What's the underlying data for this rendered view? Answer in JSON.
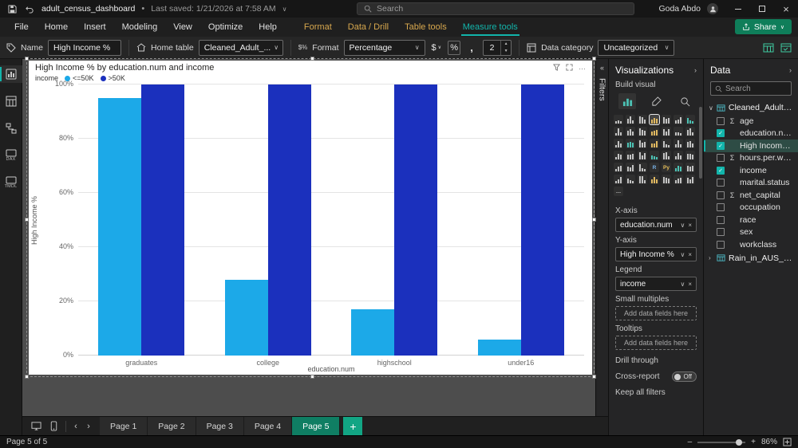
{
  "colors": {
    "accent_teal": "#12b5ab",
    "contextual_tab_yellow": "#d8a84e",
    "share_button_green": "#0f7e5a",
    "bar_light_blue": "#1ca9e8",
    "bar_dark_blue": "#1b30bd"
  },
  "icons": {
    "dot": "•",
    "chevron_down": "∨",
    "chevron_right": "›",
    "chevron_left": "‹",
    "collapse_left": "«",
    "close": "×",
    "more": "…",
    "check": "✓",
    "sigma": "Σ",
    "minus": "–",
    "plus": "+",
    "format_symbol": "$%",
    "up": "▲",
    "down": "▼"
  },
  "titlebar": {
    "filename": "adult_census_dashboard",
    "last_saved": "Last saved: 1/21/2026 at 7:58 AM",
    "search_placeholder": "Search",
    "user_name": "Goda Abdo"
  },
  "ribbon": {
    "tabs": [
      "File",
      "Home",
      "Insert",
      "Modeling",
      "View",
      "Optimize",
      "Help"
    ],
    "contextual_tabs": [
      "Format",
      "Data / Drill",
      "Table tools"
    ],
    "active_tab": "Measure tools",
    "share_label": "Share"
  },
  "toolbar": {
    "name_label": "Name",
    "name_value": "High Income %",
    "home_table_label": "Home table",
    "home_table_value": "Cleaned_Adult_...",
    "format_label": "Format",
    "format_value": "Percentage",
    "currency_label": "$",
    "percent_label": "%",
    "thousands_label": ",",
    "decimals_value": "2",
    "data_category_label": "Data category",
    "data_category_value": "Uncategorized"
  },
  "sidebar": {
    "items": [
      {
        "id": "report-view",
        "label": "",
        "active": true
      },
      {
        "id": "table-view",
        "label": "",
        "active": false
      },
      {
        "id": "model-view",
        "label": "",
        "active": false
      },
      {
        "id": "dax-query-view",
        "label": "DAX",
        "active": false
      },
      {
        "id": "tmdl-view",
        "label": "TMDL",
        "active": false
      }
    ]
  },
  "filters_pane": {
    "title": "Filters"
  },
  "chart_data": {
    "type": "bar",
    "title": "High Income % by education.num and income",
    "legend_title": "income",
    "categories": [
      "graduates",
      "college",
      "highschool",
      "under16"
    ],
    "series": [
      {
        "name": "<=50K",
        "color": "#1ca9e8",
        "values": [
          95,
          28,
          17,
          6
        ]
      },
      {
        "name": ">50K",
        "color": "#1b30bd",
        "values": [
          100,
          100,
          100,
          100
        ]
      }
    ],
    "xlabel": "education.num",
    "ylabel": "High Income %",
    "ylim": [
      0,
      100
    ],
    "yticks": [
      "0%",
      "20%",
      "40%",
      "60%",
      "80%",
      "100%"
    ],
    "legend_position": "top-left",
    "grid": true
  },
  "visualizations": {
    "title": "Visualizations",
    "build_visual_label": "Build visual",
    "selected_visual": "clustered-column-chart",
    "gallery": [
      "stacked-bar-chart",
      "stacked-column-chart",
      "clustered-bar-chart",
      "clustered-column-chart",
      "100-stacked-bar-chart",
      "100-stacked-column-chart",
      "line-chart",
      "area-chart",
      "stacked-area-chart",
      "line-and-stacked-column-chart",
      "line-and-clustered-column-chart",
      "ribbon-chart",
      "waterfall-chart",
      "funnel-chart",
      "scatter-chart",
      "pie-chart",
      "donut-chart",
      "treemap",
      "map",
      "filled-map",
      "shape-map",
      "azure-map",
      "gauge",
      "card",
      "new-card",
      "multi-row-card",
      "kpi",
      "slicer",
      "new-slicer",
      "table",
      "matrix",
      "r-script-visual",
      "python-visual",
      "key-influencers",
      "decomposition-tree",
      "qa-visual",
      "smart-narrative",
      "metrics",
      "paginated-report",
      "arcgis-maps",
      "power-apps",
      "power-automate",
      "more-visuals"
    ],
    "wells": [
      {
        "label": "X-axis",
        "chips": [
          "education.num"
        ]
      },
      {
        "label": "Y-axis",
        "chips": [
          "High Income %"
        ]
      },
      {
        "label": "Legend",
        "chips": [
          "income"
        ]
      },
      {
        "label": "Small multiples",
        "chips": []
      },
      {
        "label": "Tooltips",
        "chips": []
      }
    ],
    "placeholder": "Add data fields here",
    "drill_through_label": "Drill through",
    "cross_report_label": "Cross-report",
    "cross_report_state": "Off",
    "keep_filters_label": "Keep all filters"
  },
  "data_pane": {
    "title": "Data",
    "search_placeholder": "Search",
    "tables": [
      {
        "name": "Cleaned_Adult_Incom...",
        "expanded": true,
        "fields": [
          {
            "name": "age",
            "numeric": true,
            "checked": false,
            "selected": false
          },
          {
            "name": "education.num",
            "numeric": false,
            "checked": true,
            "selected": false
          },
          {
            "name": "High Income %",
            "numeric": false,
            "checked": true,
            "selected": true
          },
          {
            "name": "hours.per.week",
            "numeric": true,
            "checked": false,
            "selected": false
          },
          {
            "name": "income",
            "numeric": false,
            "checked": true,
            "selected": false
          },
          {
            "name": "marital.status",
            "numeric": false,
            "checked": false,
            "selected": false
          },
          {
            "name": "net_capital",
            "numeric": true,
            "checked": false,
            "selected": false
          },
          {
            "name": "occupation",
            "numeric": false,
            "checked": false,
            "selected": false
          },
          {
            "name": "race",
            "numeric": false,
            "checked": false,
            "selected": false
          },
          {
            "name": "sex",
            "numeric": false,
            "checked": false,
            "selected": false
          },
          {
            "name": "workclass",
            "numeric": false,
            "checked": false,
            "selected": false
          }
        ]
      },
      {
        "name": "Rain_in_AUS_Cleaned",
        "expanded": false,
        "fields": []
      }
    ]
  },
  "pages": {
    "tabs": [
      "Page 1",
      "Page 2",
      "Page 3",
      "Page 4",
      "Page 5"
    ],
    "active": "Page 5"
  },
  "statusbar": {
    "page_indicator": "Page 5 of 5",
    "zoom": "86%"
  }
}
